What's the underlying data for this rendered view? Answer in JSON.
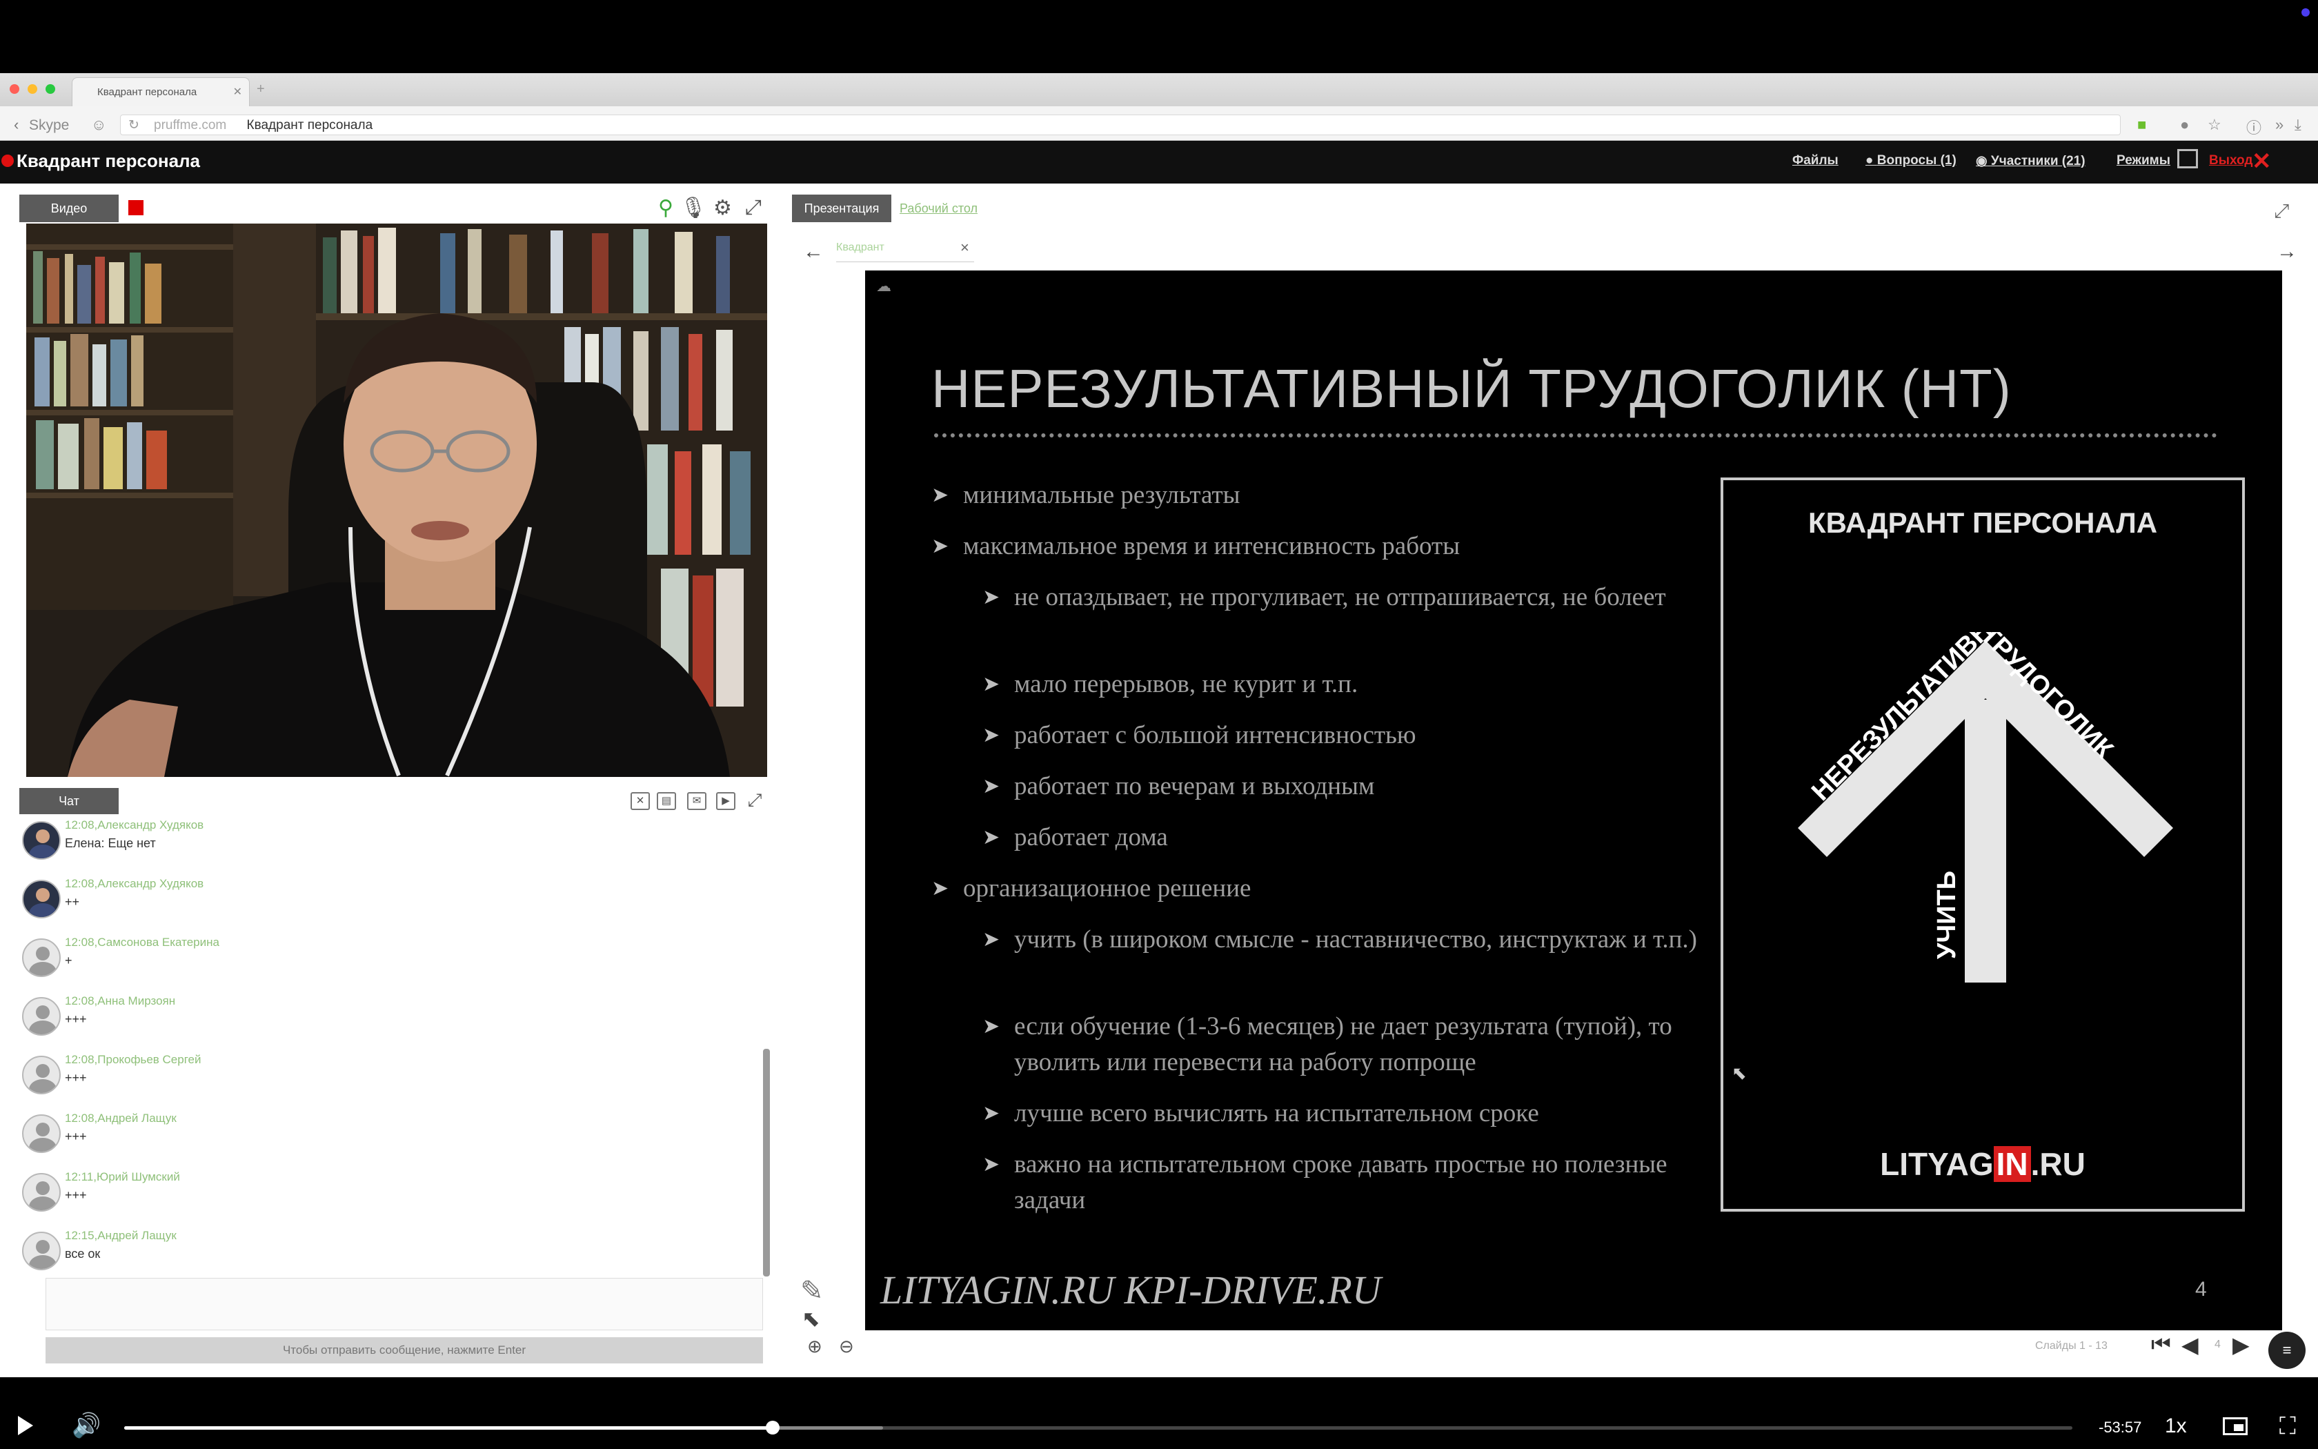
{
  "browser": {
    "tab_title": "Квадрант персонала",
    "new_tab": "+",
    "back_label": "Skype",
    "url_domain": "pruffme.com",
    "url_title": "Квадрант персонала"
  },
  "app": {
    "title": "Квадрант персонала",
    "nav": {
      "files": "Файлы",
      "questions": "Вопросы (1)",
      "participants": "Участники (21)",
      "modes": "Режимы",
      "exit": "Выход"
    }
  },
  "video_panel": {
    "tab": "Видео"
  },
  "chat": {
    "tab": "Чат",
    "messages": [
      {
        "time": "12:08,",
        "author": "Александр Худяков",
        "text": "Елена: Еще нет",
        "avatar": "photo"
      },
      {
        "time": "12:08,",
        "author": "Александр Худяков",
        "text": "++",
        "avatar": "photo"
      },
      {
        "time": "12:08,",
        "author": "Самсонова Екатерина",
        "text": "+",
        "avatar": "default"
      },
      {
        "time": "12:08,",
        "author": "Анна Мирзоян",
        "text": "+++",
        "avatar": "default"
      },
      {
        "time": "12:08,",
        "author": "Прокофьев Сергей",
        "text": "+++",
        "avatar": "default"
      },
      {
        "time": "12:08,",
        "author": "Андрей Лащук",
        "text": "+++",
        "avatar": "default"
      },
      {
        "time": "12:11,",
        "author": "Юрий Шумский",
        "text": "+++",
        "avatar": "default"
      },
      {
        "time": "12:15,",
        "author": "Андрей Лащук",
        "text": "все ок",
        "avatar": "default"
      }
    ],
    "send_hint": "Чтобы отправить сообщение, нажмите Enter"
  },
  "presentation": {
    "tab": "Презентация",
    "desktop_tab": "Рабочий стол",
    "doc_tab": "Квадрант",
    "slide": {
      "title": "НЕРЕЗУЛЬТАТИВНЫЙ ТРУДОГОЛИК (НТ)",
      "bullets": [
        {
          "level": 1,
          "text": "минимальные результаты"
        },
        {
          "level": 1,
          "text": "максимальное время и интенсивность работы"
        },
        {
          "level": 2,
          "text": "не опаздывает, не прогуливает, не отпрашивается, не болеет"
        },
        {
          "level": 2,
          "text": "мало перерывов, не курит и т.п."
        },
        {
          "level": 2,
          "text": "работает с большой интенсивностью"
        },
        {
          "level": 2,
          "text": "работает по вечерам и выходным"
        },
        {
          "level": 2,
          "text": "работает дома"
        },
        {
          "level": 1,
          "text": "организационное решение"
        },
        {
          "level": 2,
          "text": "учить (в широком смысле - наставничество, инструктаж и т.п.)"
        },
        {
          "level": 2,
          "text": "если обучение (1-3-6 месяцев) не дает результата (тупой), то уволить или перевести на работу попроще"
        },
        {
          "level": 2,
          "text": "лучше всего вычислять на испытательном сроке"
        },
        {
          "level": 2,
          "text": "важно на испытательном сроке давать простые но полезные задачи"
        }
      ],
      "card_title": "КВАДРАНТ ПЕРСОНАЛА",
      "arrow_left_label": "НЕРЕЗУЛЬТАТИВНЫЙ",
      "arrow_right_label": "ТРУДОГОЛИК",
      "arrow_stem_label": "УЧИТЬ",
      "brand_a": "LITYAG",
      "brand_in": "IN",
      "brand_b": ".RU",
      "footer": "LITYAGIN.RU  KPI-DRIVE.RU",
      "page_number": "4"
    },
    "slides_count": "Слайды 1 - 13",
    "current_page": "4"
  },
  "player": {
    "time_remaining": "-53:57",
    "speed": "1x",
    "progress_fraction": 0.333
  }
}
